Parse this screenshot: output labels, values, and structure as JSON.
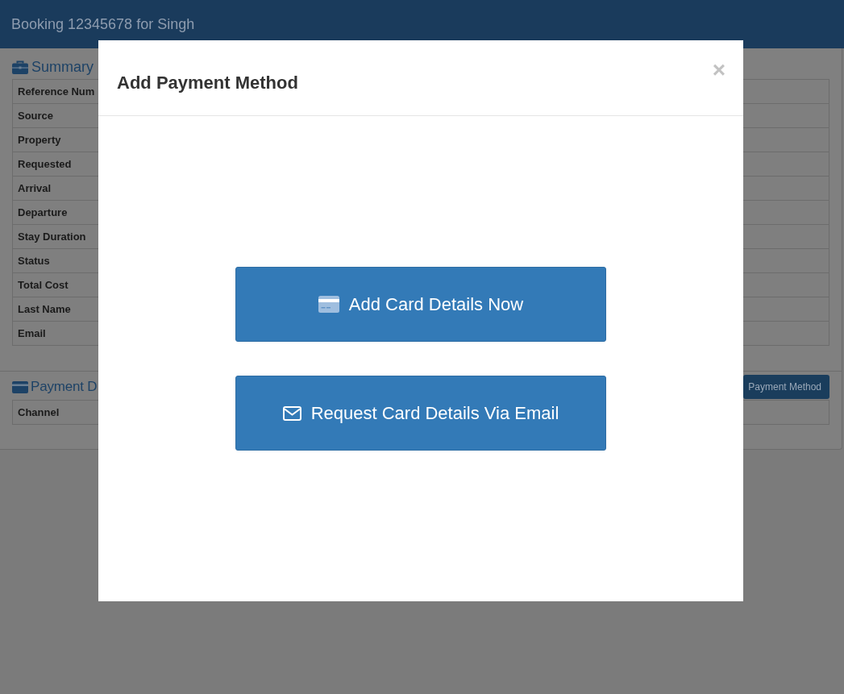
{
  "header": {
    "title": "Booking 12345678 for Singh"
  },
  "summary": {
    "title": "Summary",
    "rows": [
      "Reference Num",
      "Source",
      "Property",
      "Requested",
      "Arrival",
      "Departure",
      "Stay Duration",
      "Status",
      "Total Cost",
      "Last Name",
      "Email"
    ]
  },
  "payment_details": {
    "title": "Payment D",
    "button": "Payment Method",
    "rows": [
      "Channel"
    ]
  },
  "modal": {
    "title": "Add Payment Method",
    "close": "×",
    "actions": [
      {
        "kind": "card",
        "label": "Add Card Details Now"
      },
      {
        "kind": "email",
        "label": "Request Card Details Via Email"
      }
    ]
  }
}
